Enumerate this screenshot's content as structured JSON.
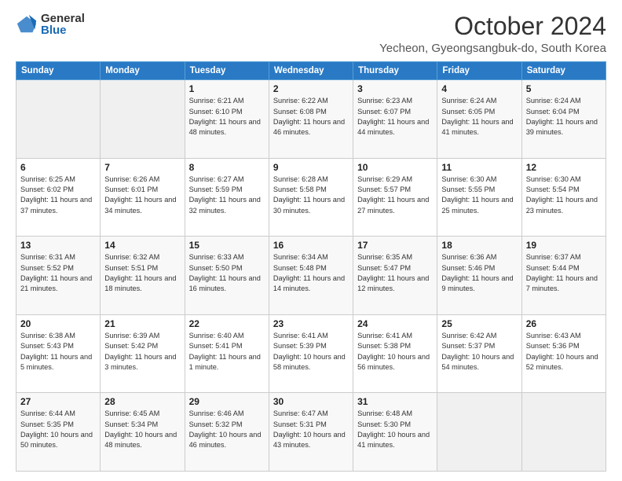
{
  "logo": {
    "general": "General",
    "blue": "Blue"
  },
  "header": {
    "month": "October 2024",
    "location": "Yecheon, Gyeongsangbuk-do, South Korea"
  },
  "days_of_week": [
    "Sunday",
    "Monday",
    "Tuesday",
    "Wednesday",
    "Thursday",
    "Friday",
    "Saturday"
  ],
  "weeks": [
    [
      {
        "day": "",
        "info": ""
      },
      {
        "day": "",
        "info": ""
      },
      {
        "day": "1",
        "info": "Sunrise: 6:21 AM\nSunset: 6:10 PM\nDaylight: 11 hours and 48 minutes."
      },
      {
        "day": "2",
        "info": "Sunrise: 6:22 AM\nSunset: 6:08 PM\nDaylight: 11 hours and 46 minutes."
      },
      {
        "day": "3",
        "info": "Sunrise: 6:23 AM\nSunset: 6:07 PM\nDaylight: 11 hours and 44 minutes."
      },
      {
        "day": "4",
        "info": "Sunrise: 6:24 AM\nSunset: 6:05 PM\nDaylight: 11 hours and 41 minutes."
      },
      {
        "day": "5",
        "info": "Sunrise: 6:24 AM\nSunset: 6:04 PM\nDaylight: 11 hours and 39 minutes."
      }
    ],
    [
      {
        "day": "6",
        "info": "Sunrise: 6:25 AM\nSunset: 6:02 PM\nDaylight: 11 hours and 37 minutes."
      },
      {
        "day": "7",
        "info": "Sunrise: 6:26 AM\nSunset: 6:01 PM\nDaylight: 11 hours and 34 minutes."
      },
      {
        "day": "8",
        "info": "Sunrise: 6:27 AM\nSunset: 5:59 PM\nDaylight: 11 hours and 32 minutes."
      },
      {
        "day": "9",
        "info": "Sunrise: 6:28 AM\nSunset: 5:58 PM\nDaylight: 11 hours and 30 minutes."
      },
      {
        "day": "10",
        "info": "Sunrise: 6:29 AM\nSunset: 5:57 PM\nDaylight: 11 hours and 27 minutes."
      },
      {
        "day": "11",
        "info": "Sunrise: 6:30 AM\nSunset: 5:55 PM\nDaylight: 11 hours and 25 minutes."
      },
      {
        "day": "12",
        "info": "Sunrise: 6:30 AM\nSunset: 5:54 PM\nDaylight: 11 hours and 23 minutes."
      }
    ],
    [
      {
        "day": "13",
        "info": "Sunrise: 6:31 AM\nSunset: 5:52 PM\nDaylight: 11 hours and 21 minutes."
      },
      {
        "day": "14",
        "info": "Sunrise: 6:32 AM\nSunset: 5:51 PM\nDaylight: 11 hours and 18 minutes."
      },
      {
        "day": "15",
        "info": "Sunrise: 6:33 AM\nSunset: 5:50 PM\nDaylight: 11 hours and 16 minutes."
      },
      {
        "day": "16",
        "info": "Sunrise: 6:34 AM\nSunset: 5:48 PM\nDaylight: 11 hours and 14 minutes."
      },
      {
        "day": "17",
        "info": "Sunrise: 6:35 AM\nSunset: 5:47 PM\nDaylight: 11 hours and 12 minutes."
      },
      {
        "day": "18",
        "info": "Sunrise: 6:36 AM\nSunset: 5:46 PM\nDaylight: 11 hours and 9 minutes."
      },
      {
        "day": "19",
        "info": "Sunrise: 6:37 AM\nSunset: 5:44 PM\nDaylight: 11 hours and 7 minutes."
      }
    ],
    [
      {
        "day": "20",
        "info": "Sunrise: 6:38 AM\nSunset: 5:43 PM\nDaylight: 11 hours and 5 minutes."
      },
      {
        "day": "21",
        "info": "Sunrise: 6:39 AM\nSunset: 5:42 PM\nDaylight: 11 hours and 3 minutes."
      },
      {
        "day": "22",
        "info": "Sunrise: 6:40 AM\nSunset: 5:41 PM\nDaylight: 11 hours and 1 minute."
      },
      {
        "day": "23",
        "info": "Sunrise: 6:41 AM\nSunset: 5:39 PM\nDaylight: 10 hours and 58 minutes."
      },
      {
        "day": "24",
        "info": "Sunrise: 6:41 AM\nSunset: 5:38 PM\nDaylight: 10 hours and 56 minutes."
      },
      {
        "day": "25",
        "info": "Sunrise: 6:42 AM\nSunset: 5:37 PM\nDaylight: 10 hours and 54 minutes."
      },
      {
        "day": "26",
        "info": "Sunrise: 6:43 AM\nSunset: 5:36 PM\nDaylight: 10 hours and 52 minutes."
      }
    ],
    [
      {
        "day": "27",
        "info": "Sunrise: 6:44 AM\nSunset: 5:35 PM\nDaylight: 10 hours and 50 minutes."
      },
      {
        "day": "28",
        "info": "Sunrise: 6:45 AM\nSunset: 5:34 PM\nDaylight: 10 hours and 48 minutes."
      },
      {
        "day": "29",
        "info": "Sunrise: 6:46 AM\nSunset: 5:32 PM\nDaylight: 10 hours and 46 minutes."
      },
      {
        "day": "30",
        "info": "Sunrise: 6:47 AM\nSunset: 5:31 PM\nDaylight: 10 hours and 43 minutes."
      },
      {
        "day": "31",
        "info": "Sunrise: 6:48 AM\nSunset: 5:30 PM\nDaylight: 10 hours and 41 minutes."
      },
      {
        "day": "",
        "info": ""
      },
      {
        "day": "",
        "info": ""
      }
    ]
  ]
}
